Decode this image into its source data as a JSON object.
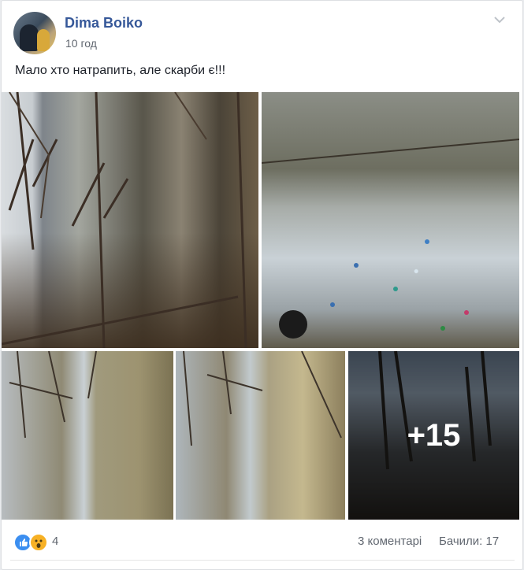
{
  "post": {
    "author": "Dima Boiko",
    "time": "10 год",
    "text": "Мало хто натрапить, але скарби є!!!"
  },
  "photos": {
    "more_count": "+15"
  },
  "footer": {
    "reactions_count": "4",
    "comments": "3 коментарі",
    "views": "Бачили: 17"
  },
  "icons": {
    "menu": "chevron-down-icon",
    "like": "like-icon",
    "wow": "wow-icon"
  },
  "colors": {
    "author_link": "#365899",
    "like_reaction": "#3b8ef0",
    "wow_reaction": "#f7b125"
  }
}
